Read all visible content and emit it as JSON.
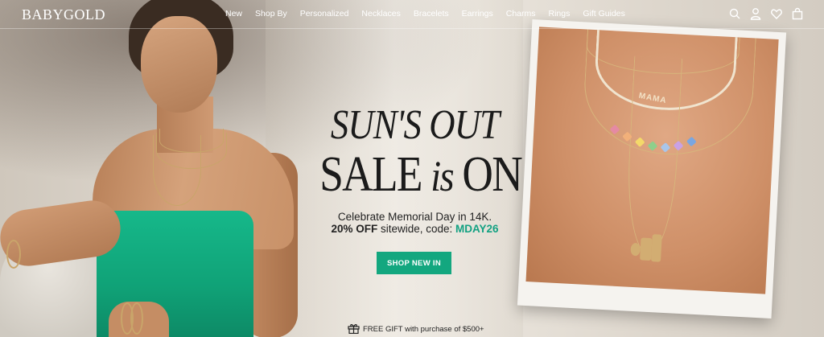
{
  "brand": {
    "logo_text": "BABYGOLD"
  },
  "nav": {
    "items": [
      {
        "label": "New"
      },
      {
        "label": "Shop By"
      },
      {
        "label": "Personalized"
      },
      {
        "label": "Necklaces"
      },
      {
        "label": "Bracelets"
      },
      {
        "label": "Earrings"
      },
      {
        "label": "Charms"
      },
      {
        "label": "Rings"
      },
      {
        "label": "Gift Guides"
      }
    ],
    "icons": [
      "search-icon",
      "account-icon",
      "wishlist-heart-icon",
      "cart-bag-icon"
    ]
  },
  "hero": {
    "headline_line1": "SUN'S OUT",
    "headline_line2_a": "SALE ",
    "headline_line2_is": "is",
    "headline_line2_b": " ON",
    "subtitle": "Celebrate Memorial Day in 14K.",
    "offer_bold": "20% OFF",
    "offer_text": " sitewide, code: ",
    "promo_code": "MDAY26",
    "cta_label": "SHOP NEW IN",
    "gift_text": "FREE GIFT with purchase of $500+",
    "polaroid_pendant_text": "MAMA"
  },
  "colors": {
    "accent": "#13a77f",
    "code_text": "#13a182",
    "header_text": "#ffffff",
    "dress": "#16b88a"
  }
}
